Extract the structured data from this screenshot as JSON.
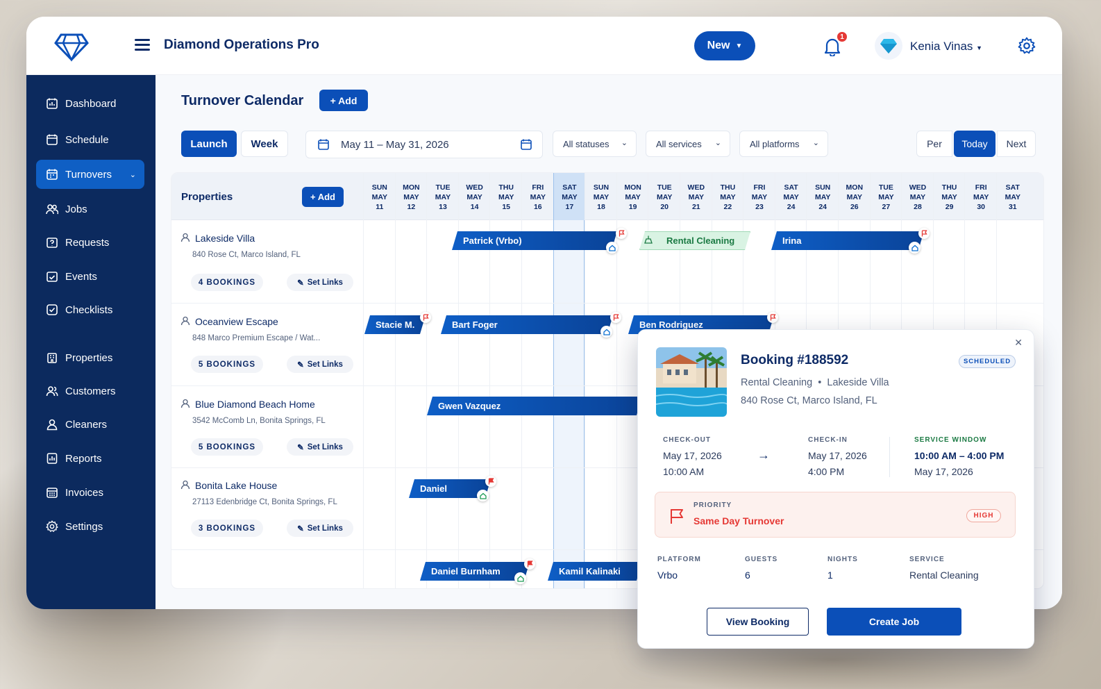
{
  "app": {
    "title": "Diamond Operations Pro",
    "new_label": "New",
    "notifications": "1",
    "user_name": "Kenia Vinas"
  },
  "sidebar": {
    "items": [
      {
        "label": "Dashboard"
      },
      {
        "label": "Schedule"
      },
      {
        "label": "Turnovers"
      },
      {
        "label": "Jobs"
      },
      {
        "label": "Requests"
      },
      {
        "label": "Events"
      },
      {
        "label": "Checklists"
      },
      {
        "label": "Properties"
      },
      {
        "label": "Customers"
      },
      {
        "label": "Cleaners"
      },
      {
        "label": "Reports"
      },
      {
        "label": "Invoices"
      },
      {
        "label": "Settings"
      }
    ]
  },
  "main": {
    "title": "Turnover Calendar",
    "add_label": "+ Add",
    "view_launch": "Launch",
    "view_week": "Week",
    "date_range": "May 11 – May 31, 2026",
    "filter_status": "All statuses",
    "filter_services": "All services",
    "filter_platforms": "All platforms",
    "nav_prev": "Per",
    "nav_today": "Today",
    "nav_next": "Next"
  },
  "calendar": {
    "properties_title": "Properties",
    "properties_add": "+ Add",
    "days": [
      {
        "dow": "SUN",
        "mon": "MAY",
        "d": "11"
      },
      {
        "dow": "MON",
        "mon": "MAY",
        "d": "12"
      },
      {
        "dow": "TUE",
        "mon": "MAY",
        "d": "13"
      },
      {
        "dow": "WED",
        "mon": "MAY",
        "d": "14"
      },
      {
        "dow": "THU",
        "mon": "MAY",
        "d": "15"
      },
      {
        "dow": "FRI",
        "mon": "MAY",
        "d": "16"
      },
      {
        "dow": "SAT",
        "mon": "MAY",
        "d": "17"
      },
      {
        "dow": "SUN",
        "mon": "MAY",
        "d": "18"
      },
      {
        "dow": "MON",
        "mon": "MAY",
        "d": "19"
      },
      {
        "dow": "TUE",
        "mon": "MAY",
        "d": "20"
      },
      {
        "dow": "WED",
        "mon": "MAY",
        "d": "21"
      },
      {
        "dow": "THU",
        "mon": "MAY",
        "d": "22"
      },
      {
        "dow": "FRI",
        "mon": "MAY",
        "d": "23"
      },
      {
        "dow": "SAT",
        "mon": "MAY",
        "d": "24"
      },
      {
        "dow": "SUN",
        "mon": "MAY",
        "d": "24"
      },
      {
        "dow": "MON",
        "mon": "MAY",
        "d": "26"
      },
      {
        "dow": "TUE",
        "mon": "MAY",
        "d": "27"
      },
      {
        "dow": "WED",
        "mon": "MAY",
        "d": "28"
      },
      {
        "dow": "THU",
        "mon": "MAY",
        "d": "29"
      },
      {
        "dow": "FRI",
        "mon": "MAY",
        "d": "30"
      },
      {
        "dow": "SAT",
        "mon": "MAY",
        "d": "31"
      }
    ],
    "properties": [
      {
        "name": "Lakeside Villa",
        "address": "840 Rose Ct, Marco Island, FL",
        "bookings": "4 BOOKINGS",
        "links": "Set Links"
      },
      {
        "name": "Oceanview Escape",
        "address": "848 Marco Premium Escape / Wat...",
        "bookings": "5 BOOKINGS",
        "links": "Set Links"
      },
      {
        "name": "Blue Diamond Beach Home",
        "address": "3542 McComb Ln, Bonita Springs, FL",
        "bookings": "5 BOOKINGS",
        "links": "Set Links"
      },
      {
        "name": "Bonita Lake House",
        "address": "27113 Edenbridge Ct, Bonita Springs, FL",
        "bookings": "3 BOOKINGS",
        "links": "Set Links"
      }
    ],
    "bars": [
      {
        "label": "Patrick (Vrbo)"
      },
      {
        "label": "Rental Cleaning"
      },
      {
        "label": "Irina"
      },
      {
        "label": "Stacie M."
      },
      {
        "label": "Bart Foger"
      },
      {
        "label": "Ben Rodriguez"
      },
      {
        "label": "Gwen Vazquez"
      },
      {
        "label": "Daniel"
      },
      {
        "label": "Daniel Burnham"
      },
      {
        "label": "Kamil Kalinaki"
      }
    ]
  },
  "popup": {
    "title": "Booking #188592",
    "status": "SCHEDULED",
    "service": "Rental Cleaning",
    "property": "Lakeside Villa",
    "address": "840 Rose Ct, Marco Island, FL",
    "checkout_label": "CHECK-OUT",
    "checkout_date": "May 17, 2026",
    "checkout_time": "10:00 AM",
    "checkin_label": "CHECK-IN",
    "checkin_date": "May 17, 2026",
    "checkin_time": "4:00 PM",
    "window_label": "SERVICE WINDOW",
    "window_time": "10:00 AM – 4:00 PM",
    "window_date": "May 17, 2026",
    "priority_label": "PRIORITY",
    "priority_value": "Same Day Turnover",
    "priority_level": "HIGH",
    "platform_label": "PLATFORM",
    "platform_value": "Vrbo",
    "guests_label": "GUESTS",
    "guests_value": "6",
    "nights_label": "NIGHTS",
    "nights_value": "1",
    "service_label": "SERVICE",
    "service_value": "Rental Cleaning",
    "view_btn": "View Booking",
    "create_btn": "Create Job"
  },
  "colors": {
    "primary": "#0b4fb8",
    "sidebar": "#0c2a5e",
    "danger": "#e53935",
    "success": "#1b7a43"
  }
}
